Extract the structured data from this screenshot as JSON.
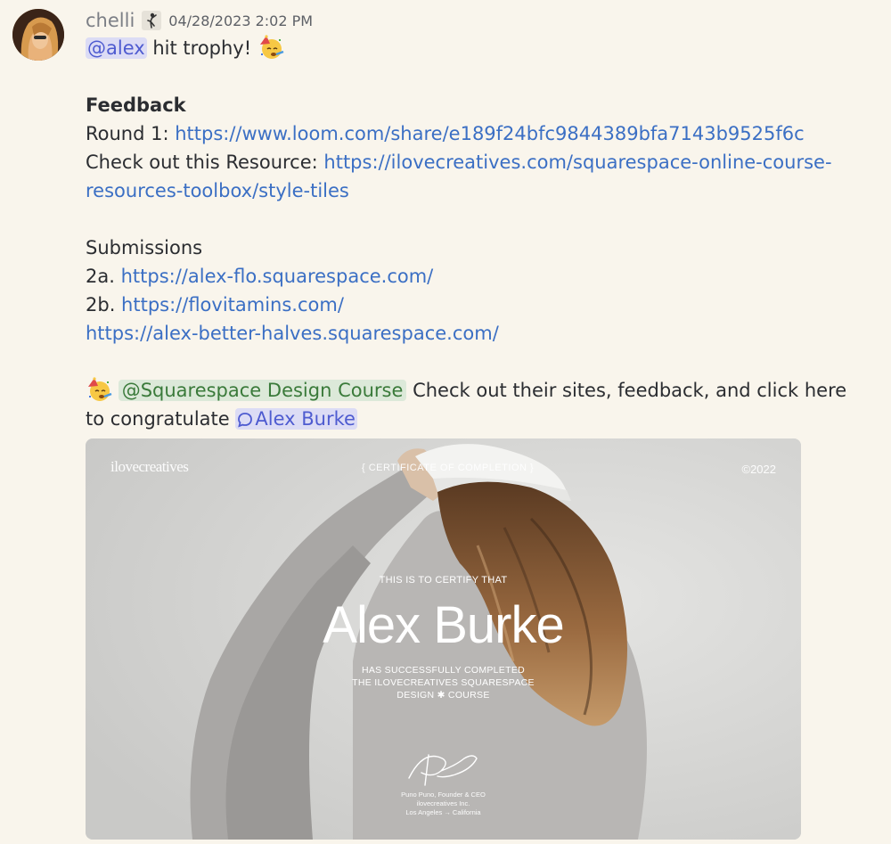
{
  "author": {
    "username": "chelli",
    "timestamp": "04/28/2023 2:02 PM"
  },
  "icons": {
    "role": "dancer-role-icon",
    "party": "partying-face-emoji",
    "thread": "thread-bubble-icon"
  },
  "message": {
    "line1_mention": "@alex",
    "line1_text": " hit trophy! ",
    "feedback_heading": "Feedback",
    "round1_label": "Round 1: ",
    "round1_link": "https://www.loom.com/share/e189f24bfc9844389bfa7143b9525f6c",
    "resource_label": "Check out this Resource: ",
    "resource_link_part1": "https://ilovecreatives.com/squarespace-online-course-",
    "resource_link_part2": "resources-toolbox/style-tiles",
    "submissions_heading": "Submissions",
    "sub_2a_label": "2a. ",
    "sub_2a_link": "https://alex-flo.squarespace.com/",
    "sub_2b_label": "2b. ",
    "sub_2b_link": "https://flovitamins.com/",
    "sub_3_link": "https://alex-better-halves.squarespace.com/",
    "role_mention": "@Squarespace Design Course",
    "congrats_text1": " Check out their sites, feedback, and click here",
    "congrats_text2": "to congratulate ",
    "thread_mention": "Alex Burke"
  },
  "certificate": {
    "brand": "ilovecreatives",
    "header_label": "{ CERTIFICATE OF COMPLETION }",
    "year": "©2022",
    "certify_label": "THIS IS TO CERTIFY THAT",
    "recipient": "Alex Burke",
    "completed_line1": "HAS SUCCESSFULLY COMPLETED",
    "completed_line2": "THE ILOVECREATIVES SQUARESPACE",
    "completed_line3": "DESIGN ✱ COURSE",
    "founder_line1": "Puno Puno, Founder & CEO",
    "founder_line2": "ilovecreatives Inc.",
    "founder_line3": "Los Angeles → California",
    "cap_text": "ilovecrea"
  },
  "colors": {
    "background": "#f9f5ec",
    "link": "#3b6fc4",
    "mention": "#4e5bd0",
    "role_mention": "#3a7a3a"
  }
}
